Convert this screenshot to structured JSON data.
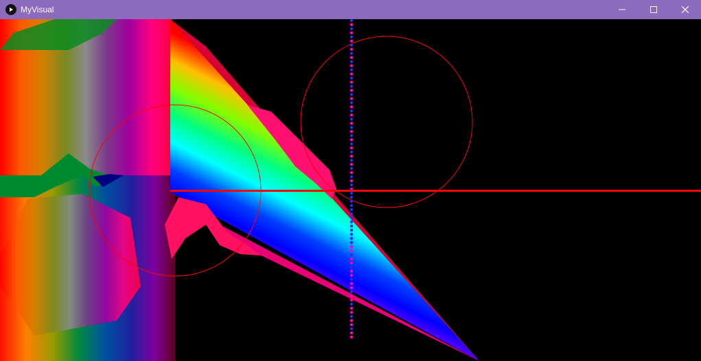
{
  "window": {
    "title": "MyVisual",
    "icon": "play-icon",
    "controls": [
      "minimize-icon",
      "maximize-icon",
      "close-icon"
    ],
    "titlebar_color": "#8c6bbd"
  },
  "canvas": {
    "background": "#000000",
    "accent_line_color": "#ff0000",
    "dot_colors": [
      "#ff00aa",
      "#2a2aff"
    ]
  }
}
